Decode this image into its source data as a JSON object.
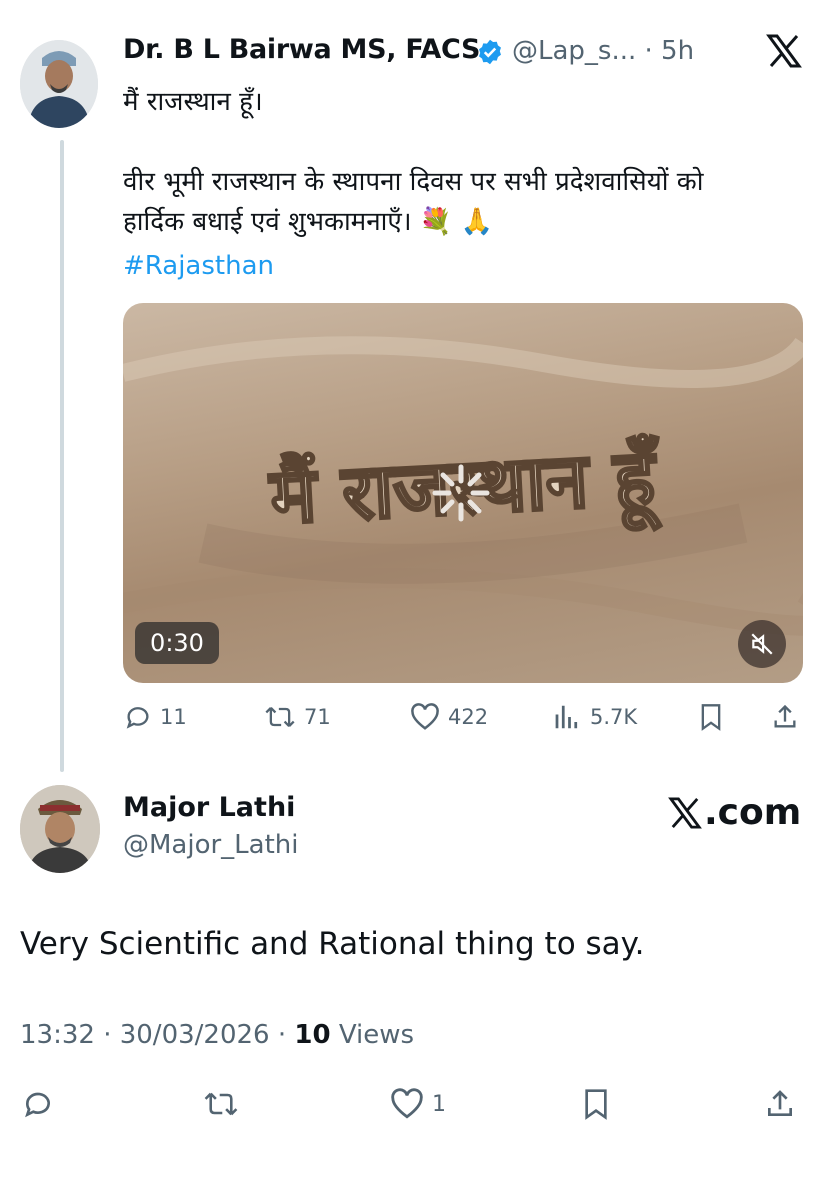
{
  "quoted_tweet": {
    "author_name": "Dr. B L Bairwa MS, FACS",
    "handle_time": "@Lap_s... · 5h",
    "text_line1": "मैं राजस्थान हूँ।",
    "text_line2": "वीर भूमी राजस्थान के स्थापना दिवस पर सभी प्रदेशवासियों को",
    "text_line3": "हार्दिक बधाई एवं शुभकामनाएँ। 💐 🙏",
    "hashtag": "#Rajasthan",
    "video": {
      "duration": "0:30",
      "overlay_text": "मैं राजस्थान हूँ"
    },
    "actions": {
      "replies": "11",
      "reposts": "71",
      "likes": "422",
      "views": "5.7K"
    }
  },
  "main_tweet": {
    "author_name": "Major Lathi",
    "handle": "@Major_Lathi",
    "brand": ".com",
    "text": "Very Scientific and Rational thing to say.",
    "timestamp": "13:32 · 30/03/2026 · ",
    "view_count": "10",
    "views_label": " Views",
    "likes": "1"
  },
  "colors": {
    "link": "#1d9bf0",
    "secondary_text": "#536471",
    "verified": "#1d9bf0"
  }
}
